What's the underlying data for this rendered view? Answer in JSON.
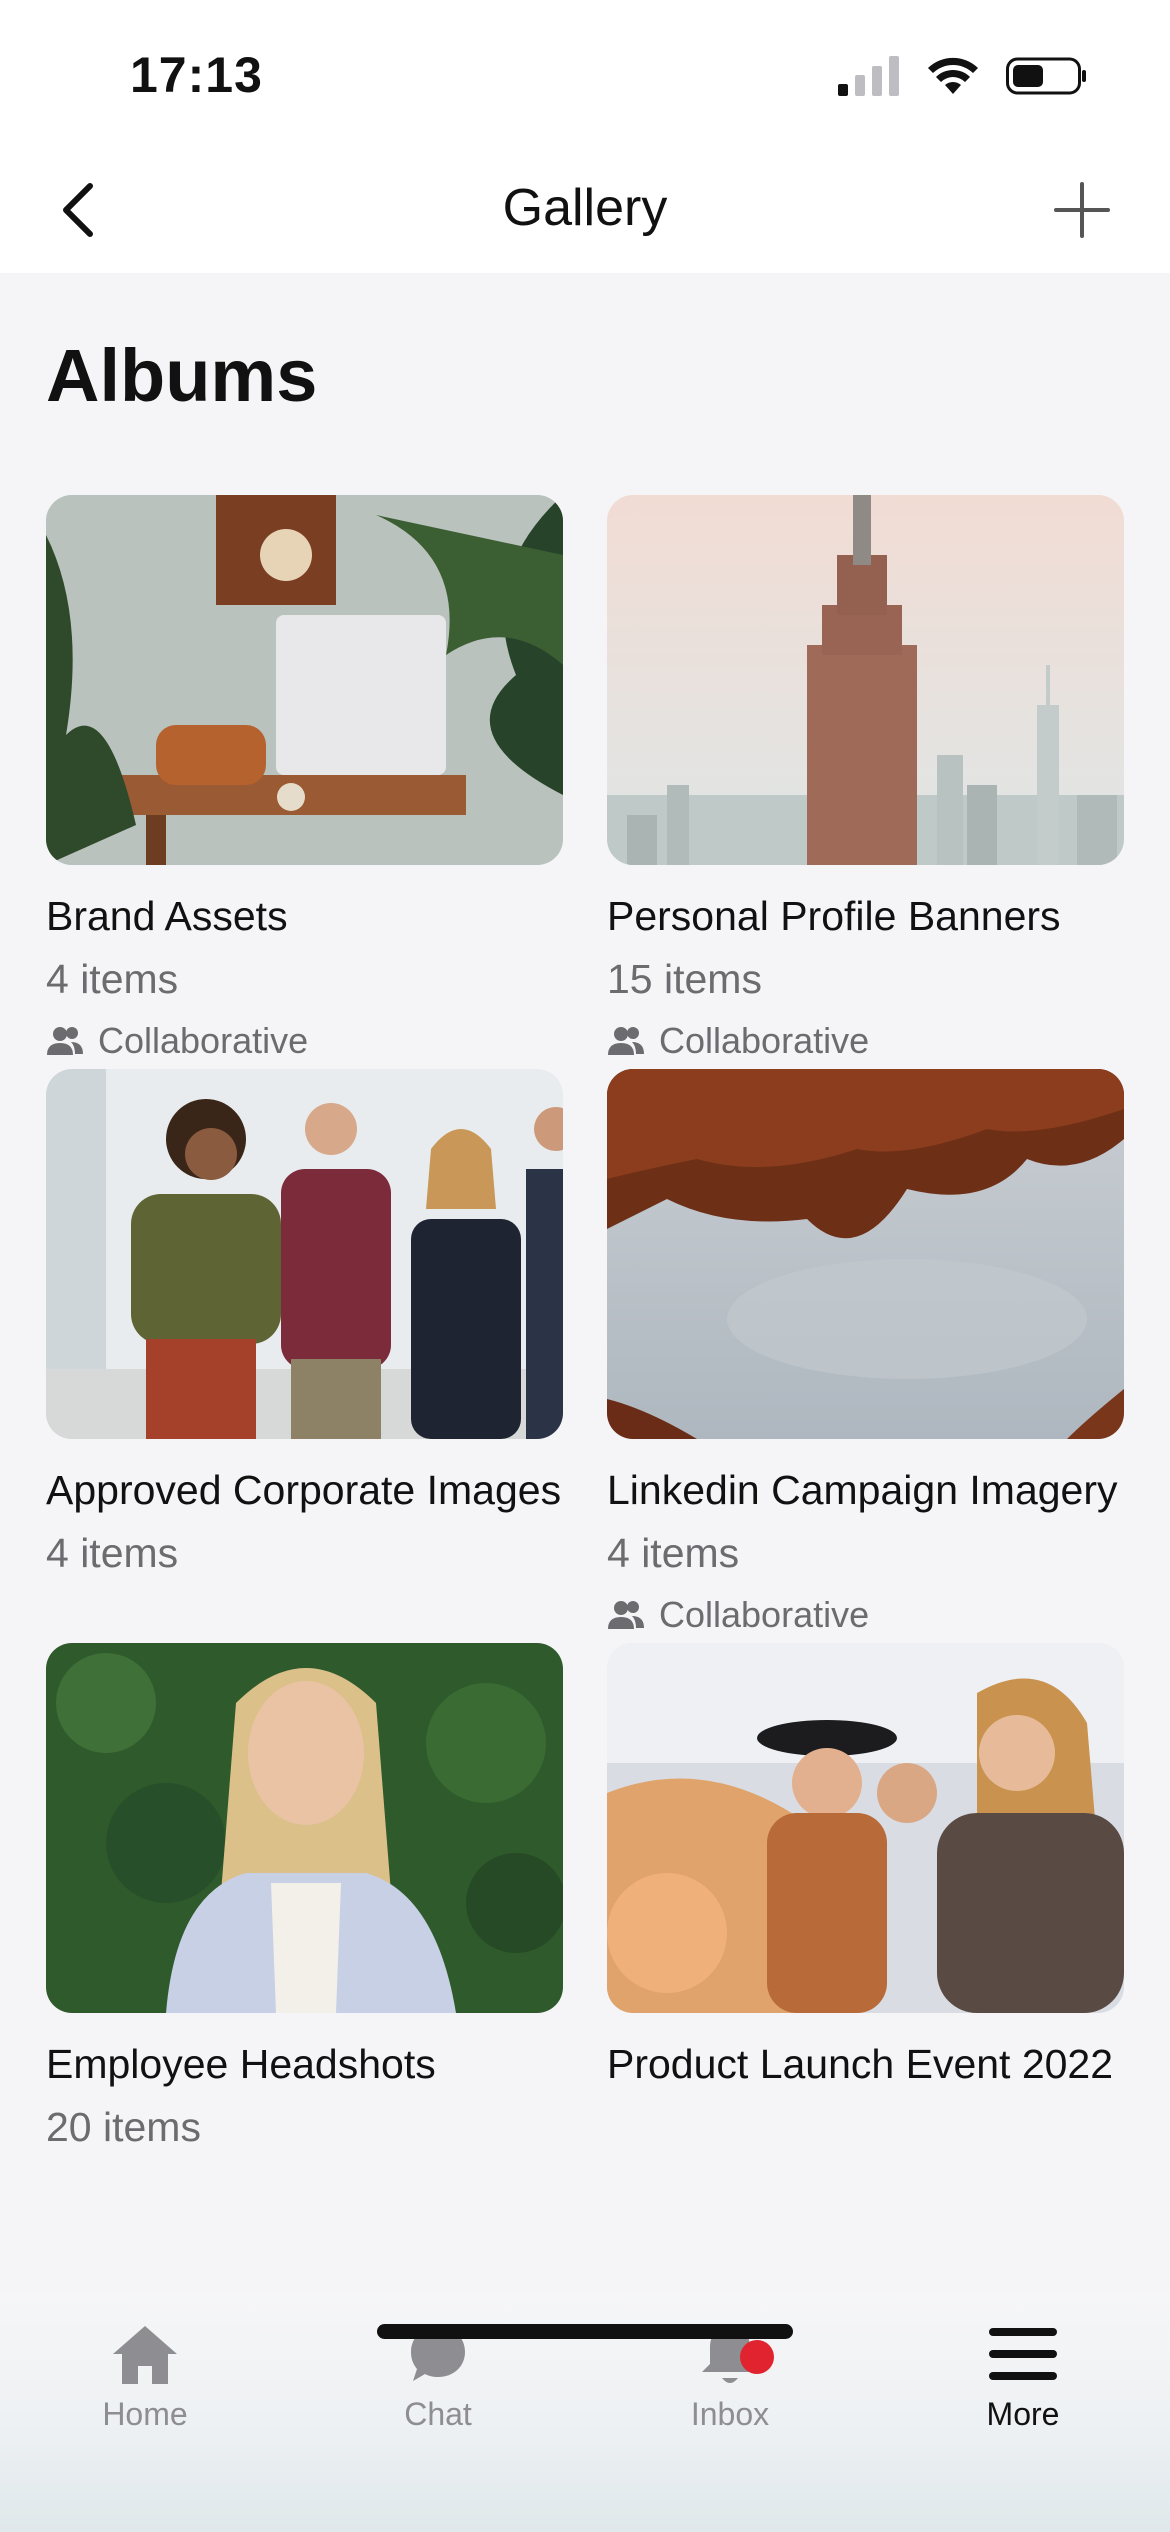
{
  "status_bar": {
    "time": "17:13"
  },
  "nav": {
    "title": "Gallery"
  },
  "section": {
    "title": "Albums"
  },
  "albums": [
    {
      "title": "Brand Assets",
      "count": "4 items",
      "collab": "Collaborative",
      "image": "office-desk-photo"
    },
    {
      "title": "Personal Profile Banners",
      "count": "15 items",
      "collab": "Collaborative",
      "image": "city-skyline-photo"
    },
    {
      "title": "Approved Corporate Images",
      "count": "4 items",
      "collab": "",
      "image": "coworkers-photo"
    },
    {
      "title": "Linkedin Campaign Imagery",
      "count": "4 items",
      "collab": "Collaborative",
      "image": "canyon-sky-photo"
    },
    {
      "title": "Employee Headshots",
      "count": "20 items",
      "collab": "",
      "image": "headshot-photo"
    },
    {
      "title": "Product Launch Event 2022",
      "count": "",
      "collab": "",
      "image": "friends-event-photo"
    }
  ],
  "tabs": [
    {
      "label": "Home",
      "icon": "home-icon"
    },
    {
      "label": "Chat",
      "icon": "chat-icon"
    },
    {
      "label": "Inbox",
      "icon": "bell-icon"
    },
    {
      "label": "More",
      "icon": "menu-icon"
    }
  ],
  "colors": {
    "badge": "#e0232e",
    "muted_text": "#6b6b70",
    "active_tab": "#111111"
  }
}
